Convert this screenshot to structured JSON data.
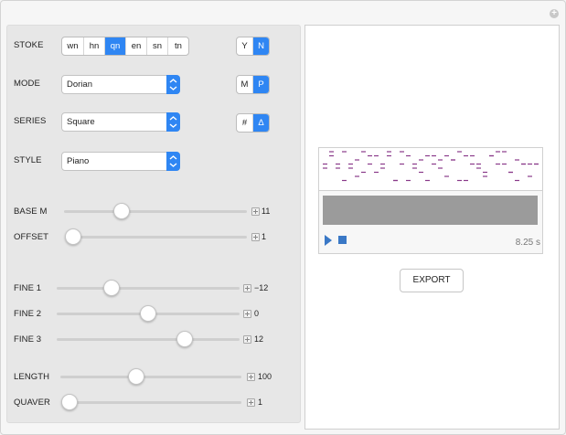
{
  "controls": {
    "stoke": {
      "label": "STOKE",
      "options": [
        "wn",
        "hn",
        "qn",
        "en",
        "sn",
        "tn"
      ],
      "selected": "qn"
    },
    "yn": {
      "options": [
        "Y",
        "N"
      ],
      "selected": "N"
    },
    "mode": {
      "label": "MODE",
      "value": "Dorian"
    },
    "mp": {
      "options": [
        "M",
        "P"
      ],
      "selected": "P"
    },
    "series": {
      "label": "SERIES",
      "value": "Square"
    },
    "sharp": {
      "options": [
        "#",
        "Δ"
      ],
      "selected": "Δ"
    },
    "style": {
      "label": "STYLE",
      "value": "Piano"
    },
    "base_m": {
      "label": "BASE M",
      "value": "11",
      "fraction": 0.3
    },
    "offset": {
      "label": "OFFSET",
      "value": "1",
      "fraction": 0.0
    },
    "fine1": {
      "label": "FINE 1",
      "value": "−12",
      "fraction": 0.28
    },
    "fine2": {
      "label": "FINE 2",
      "value": "0",
      "fraction": 0.5
    },
    "fine3": {
      "label": "FINE 3",
      "value": "12",
      "fraction": 0.72
    },
    "length": {
      "label": "LENGTH",
      "value": "100",
      "fraction": 0.41
    },
    "quaver": {
      "label": "QUAVER",
      "value": "1",
      "fraction": 0.0
    }
  },
  "output": {
    "duration": "8.25 s",
    "export_label": "EXPORT"
  },
  "colors": {
    "accent": "#2f86f3",
    "note_color": "#8a3a8a",
    "waveform": "#9b9b9b",
    "player": "#3a78c6"
  }
}
